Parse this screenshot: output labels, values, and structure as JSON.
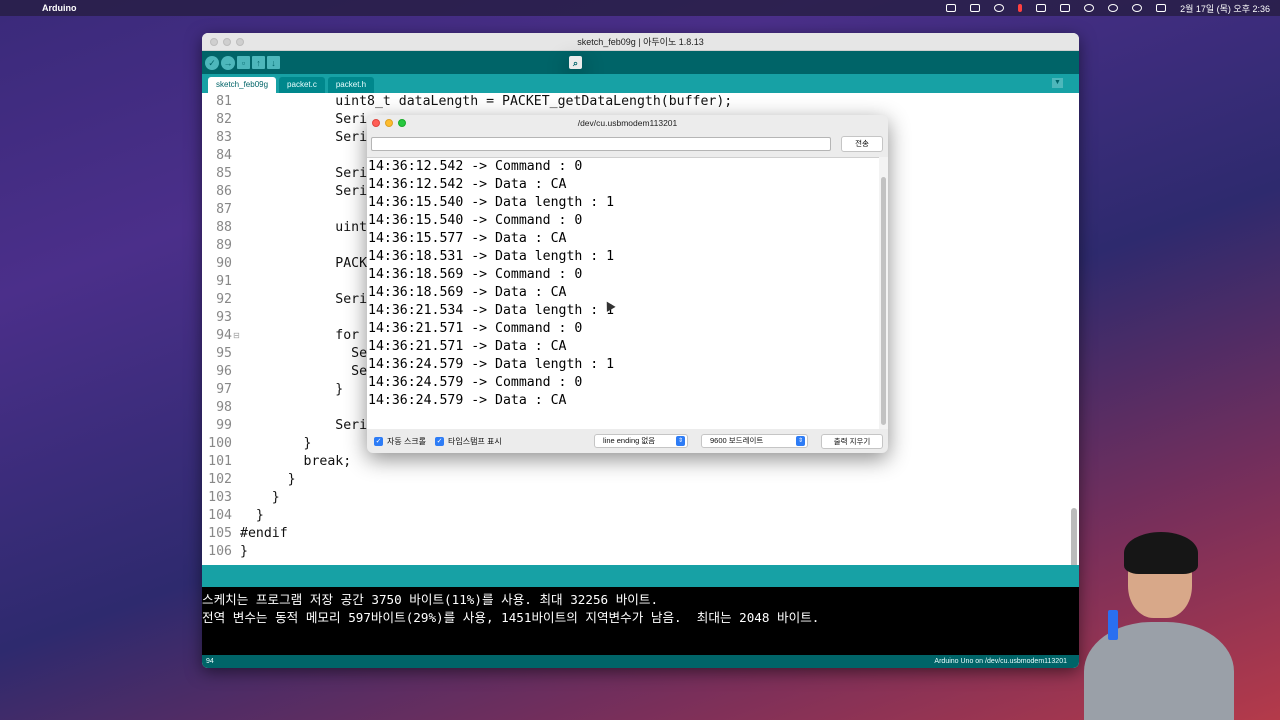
{
  "menubar": {
    "app_name": "Arduino",
    "clock": "2월 17일 (목) 오후 2:36"
  },
  "ide": {
    "title": "sketch_feb09g | 아두이노 1.8.13",
    "tabs": [
      "sketch_feb09g",
      "packet.c",
      "packet.h"
    ],
    "code_lines": [
      {
        "num": "81",
        "code": "            uint8_t dataLength = PACKET_getDataLength(buffer);"
      },
      {
        "num": "82",
        "code": "            Seri"
      },
      {
        "num": "83",
        "code": "            Seri"
      },
      {
        "num": "84",
        "code": ""
      },
      {
        "num": "85",
        "code": "            Seri"
      },
      {
        "num": "86",
        "code": "            Seri"
      },
      {
        "num": "87",
        "code": ""
      },
      {
        "num": "88",
        "code": "            uint"
      },
      {
        "num": "89",
        "code": ""
      },
      {
        "num": "90",
        "code": "            PACK"
      },
      {
        "num": "91",
        "code": ""
      },
      {
        "num": "92",
        "code": "            Seri"
      },
      {
        "num": "93",
        "code": ""
      },
      {
        "num": "94",
        "code": "            for"
      },
      {
        "num": "95",
        "code": "              Se"
      },
      {
        "num": "96",
        "code": "              Se"
      },
      {
        "num": "97",
        "code": "            }"
      },
      {
        "num": "98",
        "code": ""
      },
      {
        "num": "99",
        "code": "            Seri"
      },
      {
        "num": "100",
        "code": "        }"
      },
      {
        "num": "101",
        "code": "        break;"
      },
      {
        "num": "102",
        "code": "      }"
      },
      {
        "num": "103",
        "code": "    }"
      },
      {
        "num": "104",
        "code": "  }"
      },
      {
        "num": "105",
        "code": "#endif"
      },
      {
        "num": "106",
        "code": "}"
      }
    ],
    "console_lines": [
      "스케치는 프로그램 저장 공간 3750 바이트(11%)를 사용. 최대 32256 바이트.",
      "전역 변수는 동적 메모리 597바이트(29%)를 사용, 1451바이트의 지역변수가 남음.  최대는 2048 바이트."
    ],
    "status_line": "94",
    "board_info": "Arduino Uno on /dev/cu.usbmodem113201"
  },
  "serial": {
    "title": "/dev/cu.usbmodem113201",
    "send_label": "전송",
    "input_value": "",
    "output_lines": [
      "14:36:12.542 -> Command : 0",
      "14:36:12.542 -> Data : CA",
      "14:36:15.540 -> Data length : 1",
      "14:36:15.540 -> Command : 0",
      "14:36:15.577 -> Data : CA",
      "14:36:18.531 -> Data length : 1",
      "14:36:18.569 -> Command : 0",
      "14:36:18.569 -> Data : CA",
      "14:36:21.534 -> Data length : 1",
      "14:36:21.571 -> Command : 0",
      "14:36:21.571 -> Data : CA",
      "14:36:24.579 -> Data length : 1",
      "14:36:24.579 -> Command : 0",
      "14:36:24.579 -> Data : CA"
    ],
    "autoscroll_label": "자동 스크롤",
    "timestamp_label": "타임스탬프 표시",
    "line_ending_value": "line ending 없음",
    "baud_value": "9600 보드레이트",
    "clear_label": "출력 지우기"
  }
}
